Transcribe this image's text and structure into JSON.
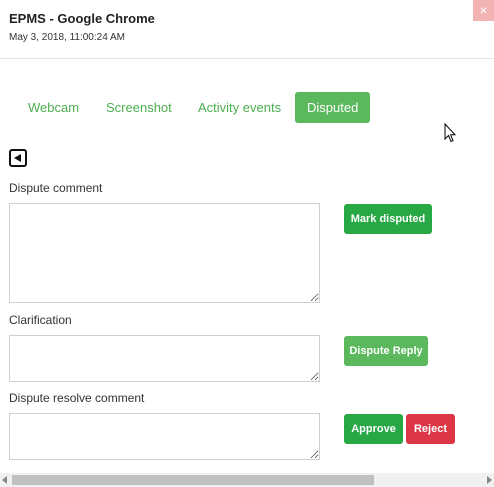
{
  "window": {
    "title": "EPMS - Google Chrome",
    "timestamp": "May 3, 2018, 11:00:24 AM",
    "close_glyph": "×"
  },
  "tabs": [
    {
      "label": "Webcam",
      "active": false
    },
    {
      "label": "Screenshot",
      "active": false
    },
    {
      "label": "Activity events",
      "active": false
    },
    {
      "label": "Disputed",
      "active": true
    }
  ],
  "form": {
    "dispute_comment_label": "Dispute comment",
    "clarification_label": "Clarification",
    "resolve_comment_label": "Dispute resolve comment",
    "dispute_comment_value": "",
    "clarification_value": "",
    "resolve_comment_value": ""
  },
  "buttons": {
    "mark_disputed": "Mark disputed",
    "dispute_reply": "Dispute Reply",
    "approve": "Approve",
    "reject": "Reject"
  },
  "colors": {
    "tab_text": "#4caf50",
    "active_tab_bg": "#5cb85c",
    "primary_green": "#28a745",
    "reject_red": "#dc3545",
    "close_bg": "#f2b3b3"
  },
  "icons": {
    "back": "back-arrow-icon",
    "close": "close-icon",
    "cursor": "mouse-pointer-icon"
  }
}
